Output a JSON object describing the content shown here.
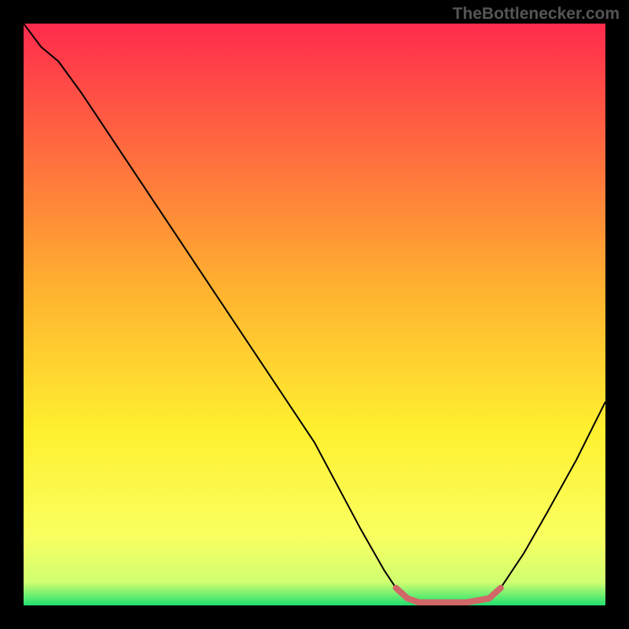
{
  "watermark": "TheBottlenecker.com",
  "chart_data": {
    "type": "line",
    "title": "",
    "xlabel": "",
    "ylabel": "",
    "xlim": [
      0,
      100
    ],
    "ylim": [
      0,
      100
    ],
    "gradient_stops": [
      {
        "offset": 0,
        "color": "#ff2b4d"
      },
      {
        "offset": 45,
        "color": "#ffb030"
      },
      {
        "offset": 70,
        "color": "#fff030"
      },
      {
        "offset": 88,
        "color": "#faff60"
      },
      {
        "offset": 96,
        "color": "#d0ff70"
      },
      {
        "offset": 100,
        "color": "#20e070"
      }
    ],
    "series": [
      {
        "name": "bottleneck-curve",
        "stroke": "#000000",
        "stroke_width": 2,
        "points": [
          {
            "x": 0,
            "y": 100
          },
          {
            "x": 3,
            "y": 96
          },
          {
            "x": 6,
            "y": 93.5
          },
          {
            "x": 10,
            "y": 88
          },
          {
            "x": 20,
            "y": 73
          },
          {
            "x": 30,
            "y": 58
          },
          {
            "x": 40,
            "y": 43
          },
          {
            "x": 50,
            "y": 28
          },
          {
            "x": 58,
            "y": 13
          },
          {
            "x": 62,
            "y": 6
          },
          {
            "x": 64,
            "y": 3
          },
          {
            "x": 66,
            "y": 1.2
          },
          {
            "x": 68,
            "y": 0.5
          },
          {
            "x": 72,
            "y": 0.5
          },
          {
            "x": 76,
            "y": 0.5
          },
          {
            "x": 80,
            "y": 1.2
          },
          {
            "x": 82,
            "y": 3
          },
          {
            "x": 86,
            "y": 9
          },
          {
            "x": 90,
            "y": 16
          },
          {
            "x": 95,
            "y": 25
          },
          {
            "x": 100,
            "y": 35
          }
        ]
      },
      {
        "name": "optimal-band",
        "stroke": "#d06868",
        "stroke_width": 8,
        "points": [
          {
            "x": 64,
            "y": 3
          },
          {
            "x": 66,
            "y": 1.2
          },
          {
            "x": 68,
            "y": 0.5
          },
          {
            "x": 72,
            "y": 0.5
          },
          {
            "x": 76,
            "y": 0.5
          },
          {
            "x": 80,
            "y": 1.2
          },
          {
            "x": 82,
            "y": 3
          }
        ]
      }
    ]
  }
}
